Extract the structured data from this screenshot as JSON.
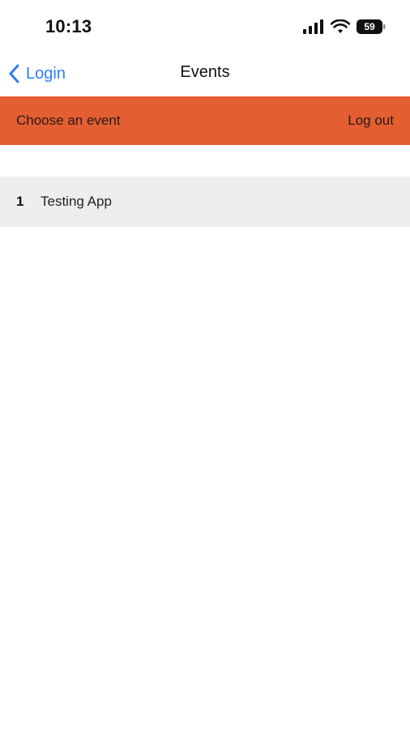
{
  "status_bar": {
    "time": "10:13",
    "battery": "59",
    "icons": [
      "signal-icon",
      "wifi-icon",
      "battery-icon"
    ]
  },
  "nav": {
    "back_label": "Login",
    "title": "Events",
    "accent_color": "#2F7CF6"
  },
  "header": {
    "subtitle": "Choose an event",
    "logout_label": "Log out",
    "background_color": "#E35F32"
  },
  "events": [
    {
      "id": "1",
      "name": "Testing App"
    }
  ]
}
